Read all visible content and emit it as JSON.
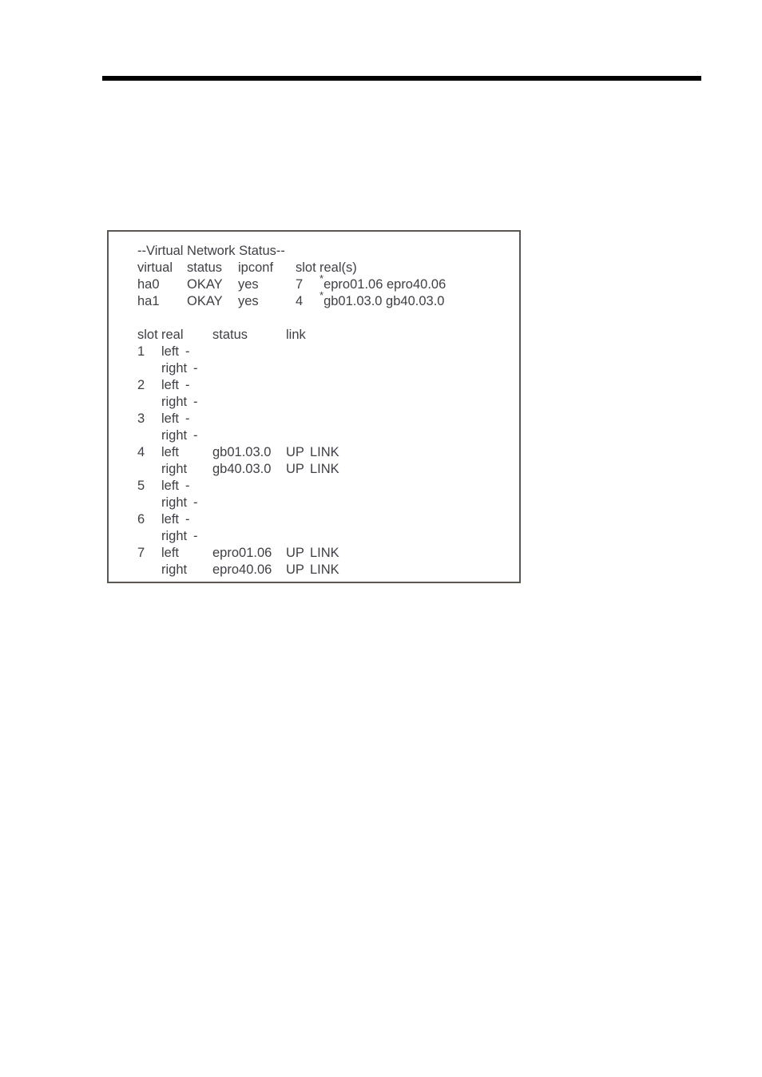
{
  "page": {
    "rule": "horizontal-rule"
  },
  "figure": {
    "title": "--Virtual Network Status--",
    "summary_table": {
      "headers": {
        "virtual": "virtual",
        "status": "status",
        "ipconf": "ipconf",
        "slot": "slot",
        "reals": "real(s)"
      },
      "rows": [
        {
          "virtual": "ha0",
          "status": "OKAY",
          "ipconf": "yes",
          "slot": "7",
          "star": "*",
          "reals": "epro01.06 epro40.06"
        },
        {
          "virtual": "ha1",
          "status": "OKAY",
          "ipconf": "yes",
          "slot": "4",
          "star": "*",
          "reals": "gb01.03.0 gb40.03.0"
        }
      ]
    },
    "slot_table": {
      "headers": {
        "slot": "slot",
        "real": "real",
        "status": "status",
        "link": "link"
      },
      "rows": [
        {
          "slot": "1",
          "real": "left",
          "iface": "-",
          "status": "",
          "link": ""
        },
        {
          "slot": "",
          "real": "right",
          "iface": "-",
          "status": "",
          "link": ""
        },
        {
          "slot": "2",
          "real": "left",
          "iface": "-",
          "status": "",
          "link": ""
        },
        {
          "slot": "",
          "real": "right",
          "iface": "-",
          "status": "",
          "link": ""
        },
        {
          "slot": "3",
          "real": "left",
          "iface": "-",
          "status": "",
          "link": ""
        },
        {
          "slot": "",
          "real": "right",
          "iface": "-",
          "status": "",
          "link": ""
        },
        {
          "slot": "4",
          "real": "left",
          "iface": "gb01.03.0",
          "status": "UP",
          "link": "LINK"
        },
        {
          "slot": "",
          "real": "right",
          "iface": "gb40.03.0",
          "status": "UP",
          "link": "LINK"
        },
        {
          "slot": "5",
          "real": "left",
          "iface": "-",
          "status": "",
          "link": ""
        },
        {
          "slot": "",
          "real": "right",
          "iface": "-",
          "status": "",
          "link": ""
        },
        {
          "slot": "6",
          "real": "left",
          "iface": "-",
          "status": "",
          "link": ""
        },
        {
          "slot": "",
          "real": "right",
          "iface": "-",
          "status": "",
          "link": ""
        },
        {
          "slot": "7",
          "real": "left",
          "iface": "epro01.06",
          "status": "UP",
          "link": "LINK"
        },
        {
          "slot": "",
          "real": "right",
          "iface": "epro40.06",
          "status": "UP",
          "link": "LINK"
        }
      ]
    }
  }
}
